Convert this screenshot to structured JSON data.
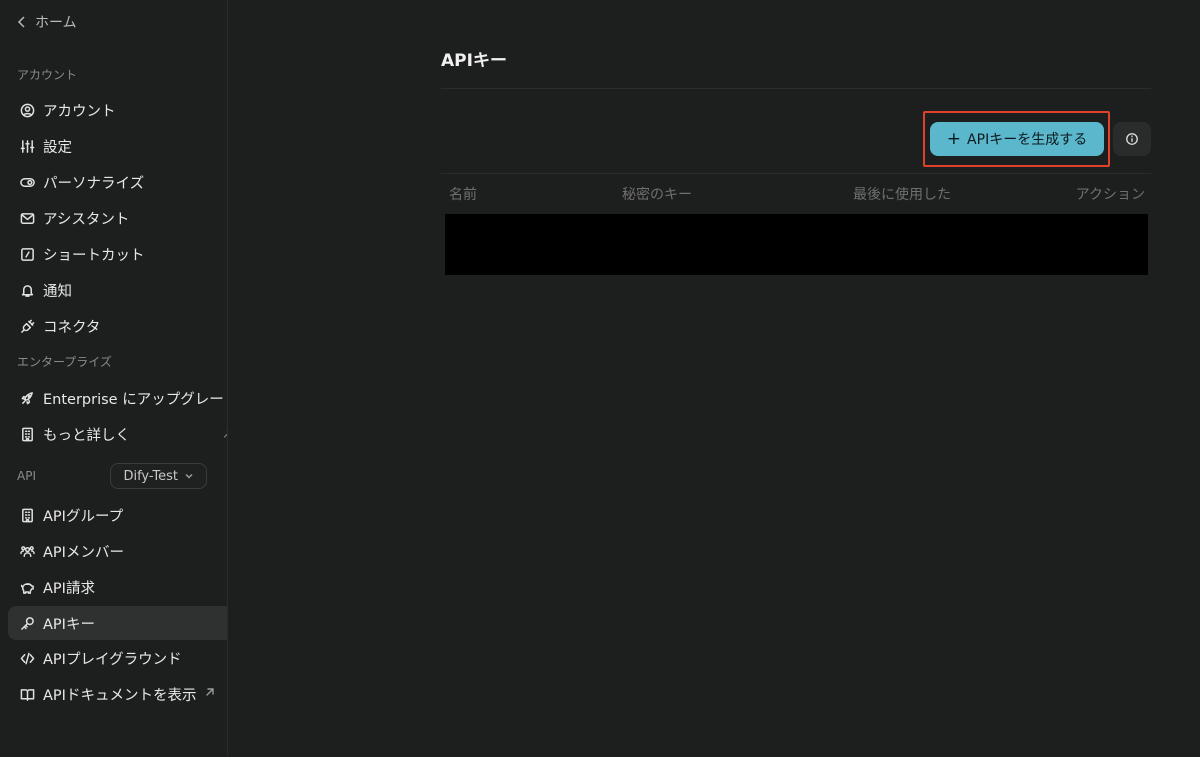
{
  "nav": {
    "home_label": "ホーム",
    "sections": {
      "account": "アカウント",
      "enterprise": "エンタープライズ",
      "api": "API"
    },
    "account_items": [
      {
        "label": "アカウント",
        "icon": "user-circle-icon"
      },
      {
        "label": "設定",
        "icon": "sliders-icon"
      },
      {
        "label": "パーソナライズ",
        "icon": "toggle-icon"
      },
      {
        "label": "アシスタント",
        "icon": "mail-icon"
      },
      {
        "label": "ショートカット",
        "icon": "shortcut-icon"
      },
      {
        "label": "通知",
        "icon": "bell-icon"
      },
      {
        "label": "コネクタ",
        "icon": "plug-icon"
      }
    ],
    "enterprise_items": [
      {
        "label": "Enterprise にアップグレード",
        "icon": "rocket-icon"
      },
      {
        "label": "もっと詳しく",
        "icon": "building-icon"
      }
    ],
    "workspace_select": "Dify-Test",
    "api_items": [
      {
        "label": "APIグループ",
        "icon": "building-icon"
      },
      {
        "label": "APIメンバー",
        "icon": "users-icon"
      },
      {
        "label": "API請求",
        "icon": "piggy-bank-icon"
      },
      {
        "label": "APIキー",
        "icon": "key-icon",
        "active": true
      },
      {
        "label": "APIプレイグラウンド",
        "icon": "code-icon"
      },
      {
        "label": "APIドキュメントを表示",
        "icon": "book-icon",
        "external": true
      }
    ]
  },
  "main": {
    "title": "APIキー",
    "create_button": "APIキーを生成する",
    "table": {
      "columns": [
        "名前",
        "秘密のキー",
        "最後に使用した",
        "アクション"
      ]
    }
  },
  "colors": {
    "background": "#1d1e1e",
    "accent": "#5bb7cc",
    "highlight": "#e0412b"
  }
}
